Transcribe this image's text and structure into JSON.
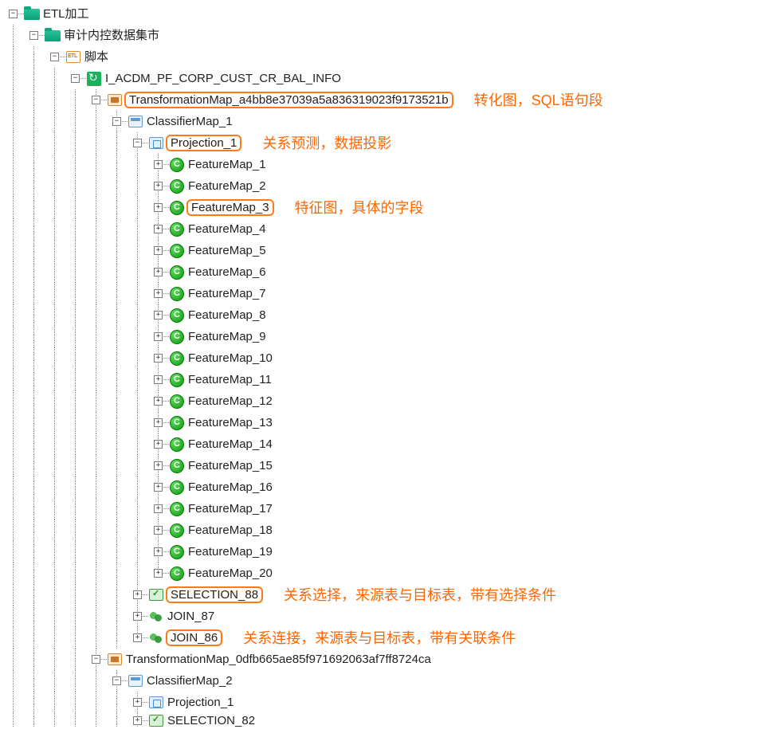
{
  "tree": {
    "root": {
      "label": "ETL加工"
    },
    "mart": {
      "label": "审计内控数据集市"
    },
    "scripts": {
      "label": "脚本"
    },
    "job": {
      "label": "I_ACDM_PF_CORP_CUST_CR_BAL_INFO"
    },
    "tmap1": {
      "label": "TransformationMap_a4bb8e37039a5a836319023f9173521b"
    },
    "cmap1": {
      "label": "ClassifierMap_1"
    },
    "proj1": {
      "label": "Projection_1"
    },
    "features": [
      "FeatureMap_1",
      "FeatureMap_2",
      "FeatureMap_3",
      "FeatureMap_4",
      "FeatureMap_5",
      "FeatureMap_6",
      "FeatureMap_7",
      "FeatureMap_8",
      "FeatureMap_9",
      "FeatureMap_10",
      "FeatureMap_11",
      "FeatureMap_12",
      "FeatureMap_13",
      "FeatureMap_14",
      "FeatureMap_15",
      "FeatureMap_16",
      "FeatureMap_17",
      "FeatureMap_18",
      "FeatureMap_19",
      "FeatureMap_20"
    ],
    "sel88": {
      "label": "SELECTION_88"
    },
    "join87": {
      "label": "JOIN_87"
    },
    "join86": {
      "label": "JOIN_86"
    },
    "tmap2": {
      "label": "TransformationMap_0dfb665ae85f971692063af7ff8724ca"
    },
    "cmap2": {
      "label": "ClassifierMap_2"
    },
    "proj2": {
      "label": "Projection_1"
    },
    "sel82": {
      "label": "SELECTION_82"
    }
  },
  "annotations": {
    "tmap": "转化图，SQL语句段",
    "proj": "关系预测，数据投影",
    "feature": "特征图，具体的字段",
    "selection": "关系选择，来源表与目标表，带有选择条件",
    "join": "关系连接，来源表与目标表，带有关联条件"
  }
}
